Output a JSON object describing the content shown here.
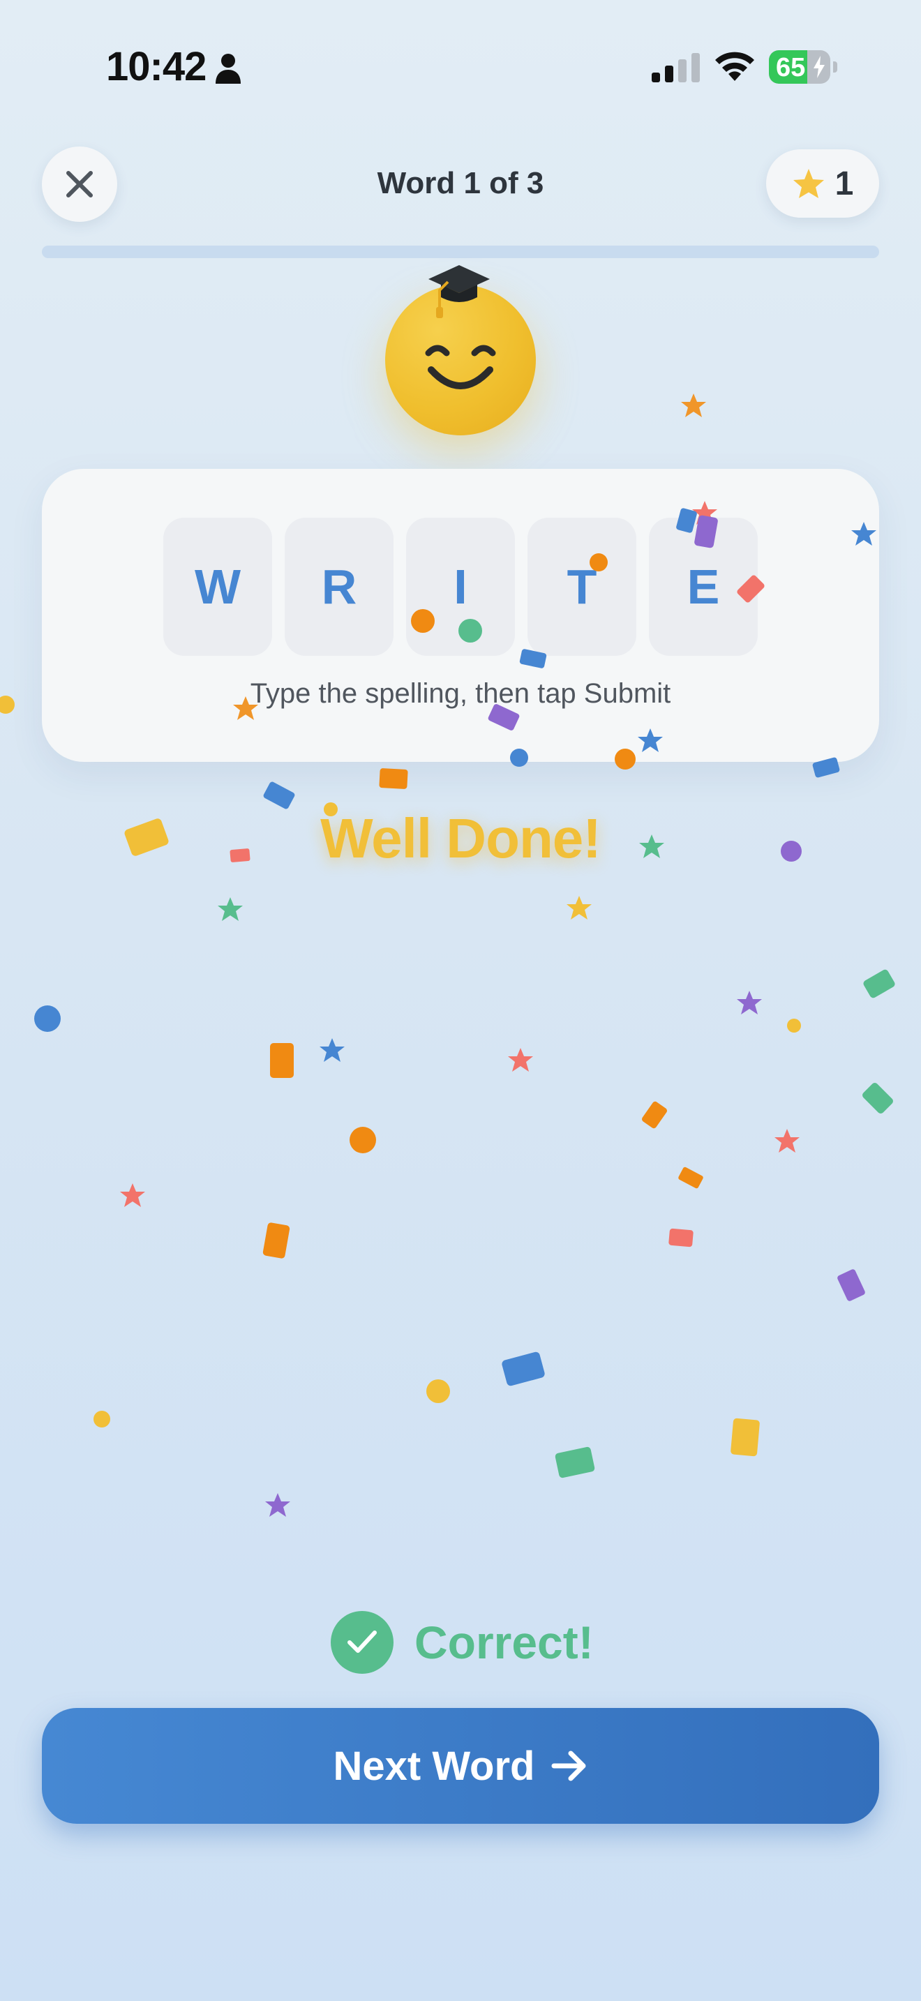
{
  "status_bar": {
    "time": "10:42",
    "battery_level": "65"
  },
  "header": {
    "title": "Word 1 of 3",
    "stars": "1"
  },
  "progress": {
    "fraction": 0.0
  },
  "word": {
    "letters": [
      "W",
      "R",
      "I",
      "T",
      "E"
    ],
    "hint": "Type the spelling, then tap Submit"
  },
  "celebration": {
    "text": "Well Done!"
  },
  "result": {
    "text": "Correct!"
  },
  "next_button": {
    "label": "Next Word"
  },
  "colors": {
    "accent_blue": "#4686d2",
    "success_green": "#57bd8d",
    "star_yellow": "#f1bf38"
  },
  "icons": [
    "person-icon",
    "signal-icon",
    "wifi-icon",
    "battery-icon",
    "close-icon",
    "star-icon",
    "graduation-cap-icon",
    "check-icon",
    "arrow-right-icon"
  ]
}
